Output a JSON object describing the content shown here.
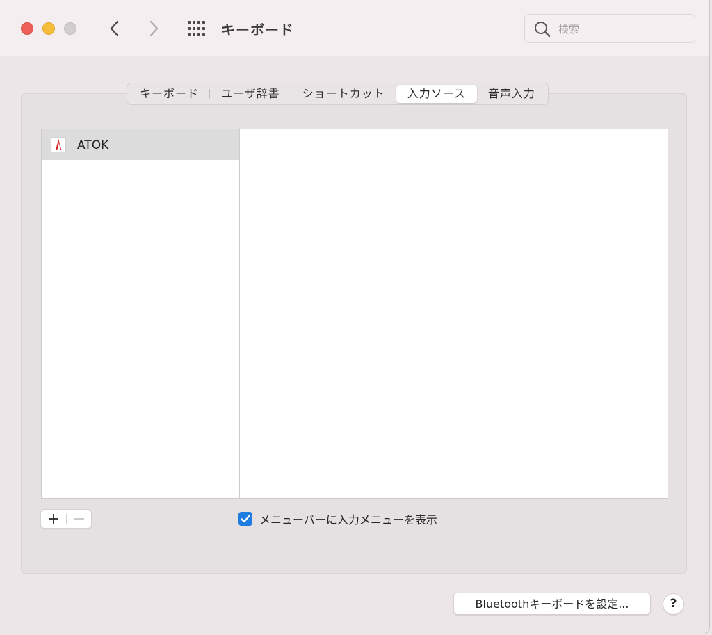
{
  "window": {
    "title": "キーボード"
  },
  "search": {
    "placeholder": "検索"
  },
  "tabs": [
    {
      "label": "キーボード",
      "active": false
    },
    {
      "label": "ユーザ辞書",
      "active": false
    },
    {
      "label": "ショートカット",
      "active": false
    },
    {
      "label": "入力ソース",
      "active": true
    },
    {
      "label": "音声入力",
      "active": false
    }
  ],
  "input_sources": {
    "items": [
      {
        "label": "ATOK",
        "icon": "atok-icon",
        "selected": true
      }
    ]
  },
  "controls": {
    "add_label": "+",
    "remove_label": "−",
    "show_input_menu_label": "メニューバーに入力メニューを表示",
    "show_input_menu_checked": true,
    "bluetooth_button_label": "Bluetoothキーボードを設定...",
    "help_label": "?"
  },
  "colors": {
    "accent": "#1f7ce0",
    "close": "#ee5f59",
    "minimize": "#f6bd3b",
    "zoom_disabled": "#d1cdcf",
    "atok_red": "#d8201c"
  }
}
